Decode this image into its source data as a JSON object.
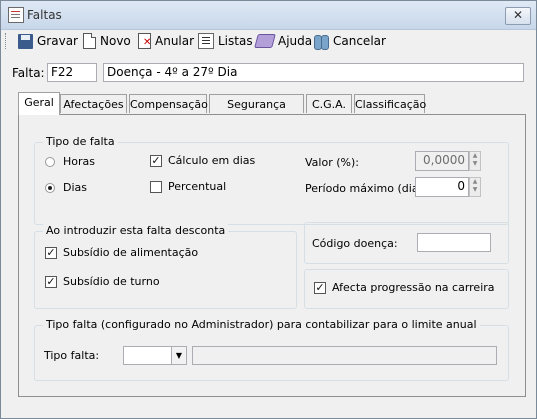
{
  "window": {
    "title": "Faltas",
    "close_glyph": "✕"
  },
  "toolbar": {
    "save": {
      "label": "Gravar",
      "icon": "save-icon"
    },
    "new": {
      "label": "Novo",
      "icon": "new-document-icon"
    },
    "void": {
      "label": "Anular",
      "icon": "void-document-icon"
    },
    "lists": {
      "label": "Listas",
      "icon": "list-icon"
    },
    "help": {
      "label": "Ajuda",
      "icon": "help-book-icon"
    },
    "cancel": {
      "label": "Cancelar",
      "icon": "cancel-icon"
    }
  },
  "falta": {
    "label": "Falta:",
    "code": "F22",
    "description": "Doença - 4º a 27º Dia"
  },
  "tabs": [
    {
      "label": "Geral",
      "active": true
    },
    {
      "label": "Afectações",
      "active": false
    },
    {
      "label": "Compensação",
      "active": false
    },
    {
      "label": "Segurança Social",
      "active": false
    },
    {
      "label": "C.G.A.",
      "active": false
    },
    {
      "label": "Classificação",
      "active": false
    }
  ],
  "tipo_falta_group": {
    "legend": "Tipo de falta",
    "radios": [
      {
        "label": "Horas",
        "selected": false
      },
      {
        "label": "Dias",
        "selected": true
      }
    ],
    "calculo_dias": {
      "label": "Cálculo em dias",
      "checked": true
    },
    "percentual": {
      "label": "Percentual",
      "checked": false
    },
    "valor": {
      "label": "Valor (%):",
      "value": "0,0000"
    },
    "periodo_maximo": {
      "label": "Período máximo (dias):",
      "value": "0"
    },
    "spin_up": "▲",
    "spin_down": "▼"
  },
  "desconta_group": {
    "legend": "Ao introduzir esta falta desconta",
    "subsidio_alimentacao": {
      "label": "Subsídio de alimentação",
      "checked": true
    },
    "subsidio_turno": {
      "label": "Subsídio de turno",
      "checked": true
    }
  },
  "codigo_doenca": {
    "label": "Código doença:",
    "value": ""
  },
  "afecta_progressao": {
    "label": "Afecta progressão na carreira",
    "checked": true
  },
  "limite_anual_group": {
    "legend": "Tipo falta (configurado no Administrador) para contabilizar para o limite anual",
    "tipo_falta_label": "Tipo falta:",
    "selected_value": "",
    "description_value": "",
    "dropdown_glyph": "▼"
  },
  "check_glyph": "✓"
}
